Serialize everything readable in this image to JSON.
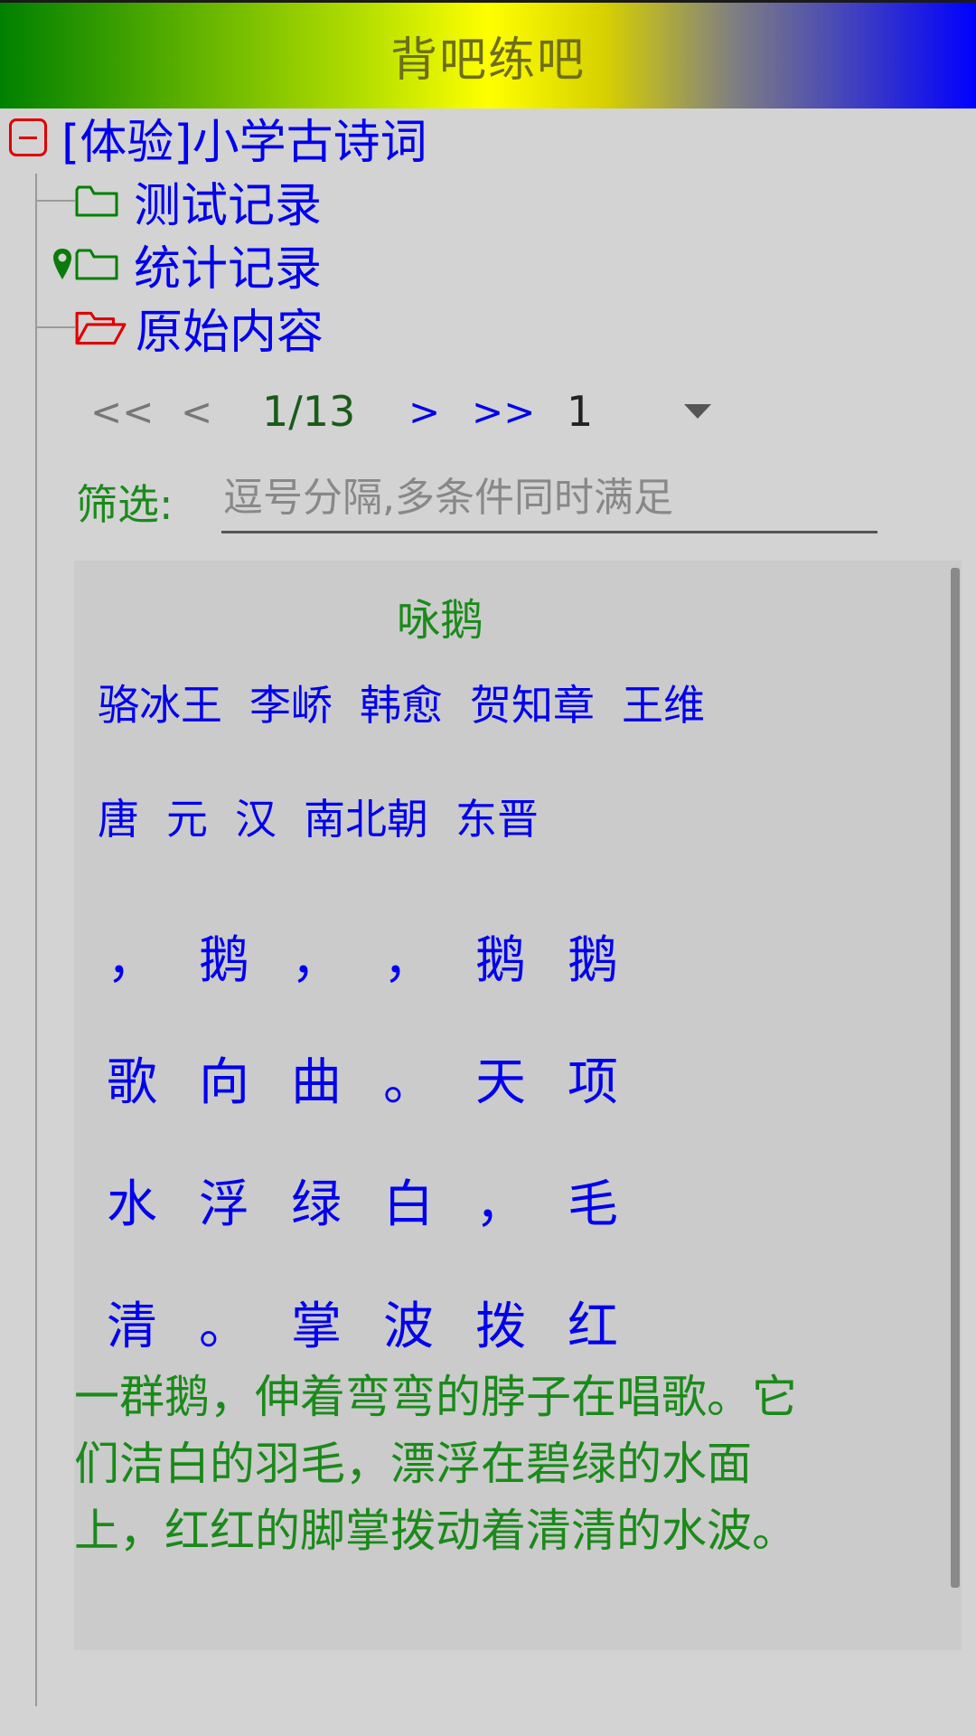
{
  "app": {
    "title": "背吧练吧"
  },
  "tree": {
    "root_label": "[体验]小学古诗词",
    "children": [
      {
        "label": "测试记录"
      },
      {
        "label": "统计记录"
      },
      {
        "label": "原始内容"
      }
    ]
  },
  "pager": {
    "first": "<<",
    "prev": "<",
    "info": "1/13",
    "next": ">",
    "last": ">>",
    "selected": "1"
  },
  "filter": {
    "label": "筛选:",
    "placeholder": "逗号分隔,多条件同时满足",
    "value": ""
  },
  "poem": {
    "title": "咏鹅",
    "authors": [
      "骆冰王",
      "李峤",
      "韩愈",
      "贺知章",
      "王维"
    ],
    "dynasties": [
      "唐",
      "元",
      "汉",
      "南北朝",
      "东晋"
    ],
    "grid": [
      [
        "，",
        "鹅",
        "，",
        "，",
        "鹅",
        "鹅"
      ],
      [
        "歌",
        "向",
        "曲",
        "。",
        "天",
        "项"
      ],
      [
        "水",
        "浮",
        "绿",
        "白",
        "，",
        "毛"
      ],
      [
        "清",
        "。",
        "掌",
        "波",
        "拨",
        "红"
      ]
    ],
    "translation": "一群鹅，伸着弯弯的脖子在唱歌。它们洁白的羽毛，漂浮在碧绿的水面上，红红的脚掌拨动着清清的水波。"
  },
  "colors": {
    "link_blue": "#0000ee",
    "accent_green": "#1a8a1a",
    "expand_red": "#e00000",
    "folder_green": "#008000",
    "folder_open_red": "#e00000"
  },
  "icons": {
    "root": "collapse-minus-icon",
    "folder_closed": "folder-icon",
    "folder_open": "folder-open-icon",
    "pin": "location-pin-icon",
    "dropdown": "dropdown-arrow-icon"
  }
}
